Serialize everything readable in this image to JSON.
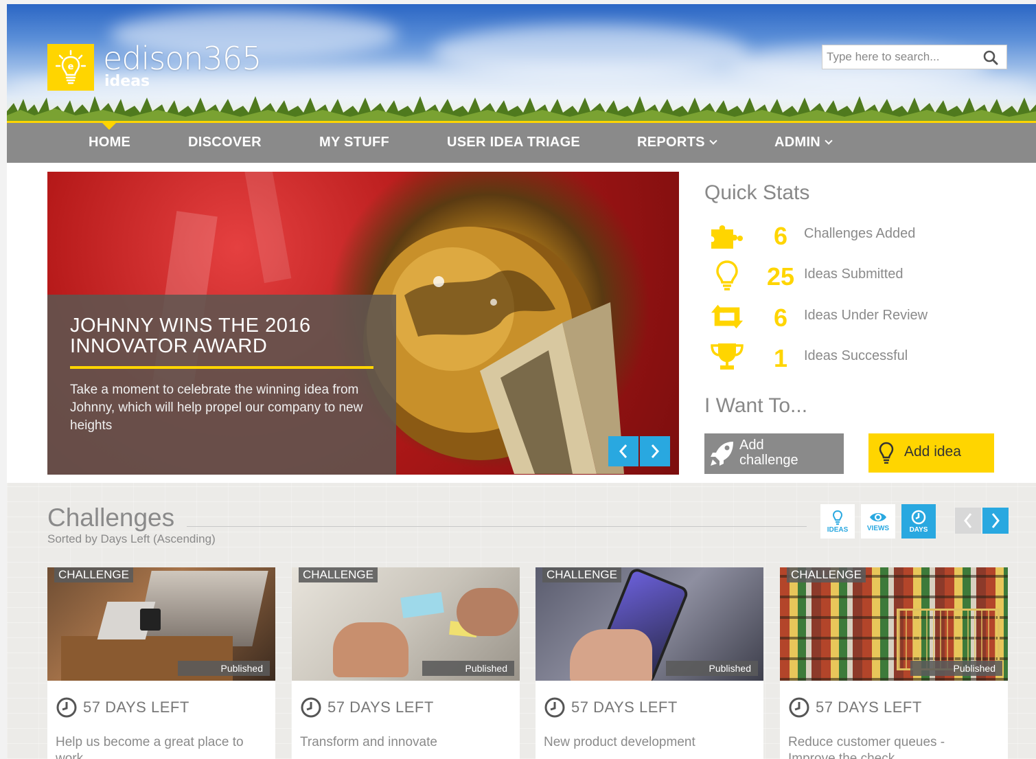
{
  "brand": {
    "name": "edison365",
    "sub": "ideas",
    "accent": "#ffd500",
    "blue": "#29a8e0"
  },
  "search": {
    "placeholder": "Type here to search..."
  },
  "nav": {
    "items": [
      {
        "label": "HOME"
      },
      {
        "label": "DISCOVER"
      },
      {
        "label": "MY STUFF"
      },
      {
        "label": "USER IDEA TRIAGE"
      },
      {
        "label": "REPORTS"
      },
      {
        "label": "ADMIN"
      }
    ]
  },
  "hero": {
    "title": "JOHNNY WINS THE 2016 INNOVATOR AWARD",
    "text": "Take a moment to celebrate the winning idea from Johnny, which will help propel our company to new heights"
  },
  "quick_stats": {
    "title": "Quick Stats",
    "items": [
      {
        "value": "6",
        "label": "Challenges Added",
        "icon": "puzzle-icon"
      },
      {
        "value": "25",
        "label": "Ideas Submitted",
        "icon": "lightbulb-icon"
      },
      {
        "value": "6",
        "label": "Ideas Under Review",
        "icon": "retweet-icon"
      },
      {
        "value": "1",
        "label": "Ideas Successful",
        "icon": "trophy-icon"
      }
    ]
  },
  "iwant": {
    "title": "I Want To...",
    "add_challenge": "Add challenge",
    "add_idea": "Add idea"
  },
  "challenges": {
    "title": "Challenges",
    "subtitle": "Sorted by Days Left (Ascending)",
    "sort": {
      "ideas": "IDEAS",
      "views": "VIEWS",
      "days": "DAYS"
    },
    "cards": [
      {
        "tag": "CHALLENGE",
        "status": "Published",
        "days": "57 DAYS LEFT",
        "title": "Help us become a great place to work"
      },
      {
        "tag": "CHALLENGE",
        "status": "Published",
        "days": "57 DAYS LEFT",
        "title": "Transform and innovate"
      },
      {
        "tag": "CHALLENGE",
        "status": "Published",
        "days": "57 DAYS LEFT",
        "title": "New product development"
      },
      {
        "tag": "CHALLENGE",
        "status": "Published",
        "days": "57 DAYS LEFT",
        "title": "Reduce customer queues - Improve the check"
      }
    ]
  }
}
